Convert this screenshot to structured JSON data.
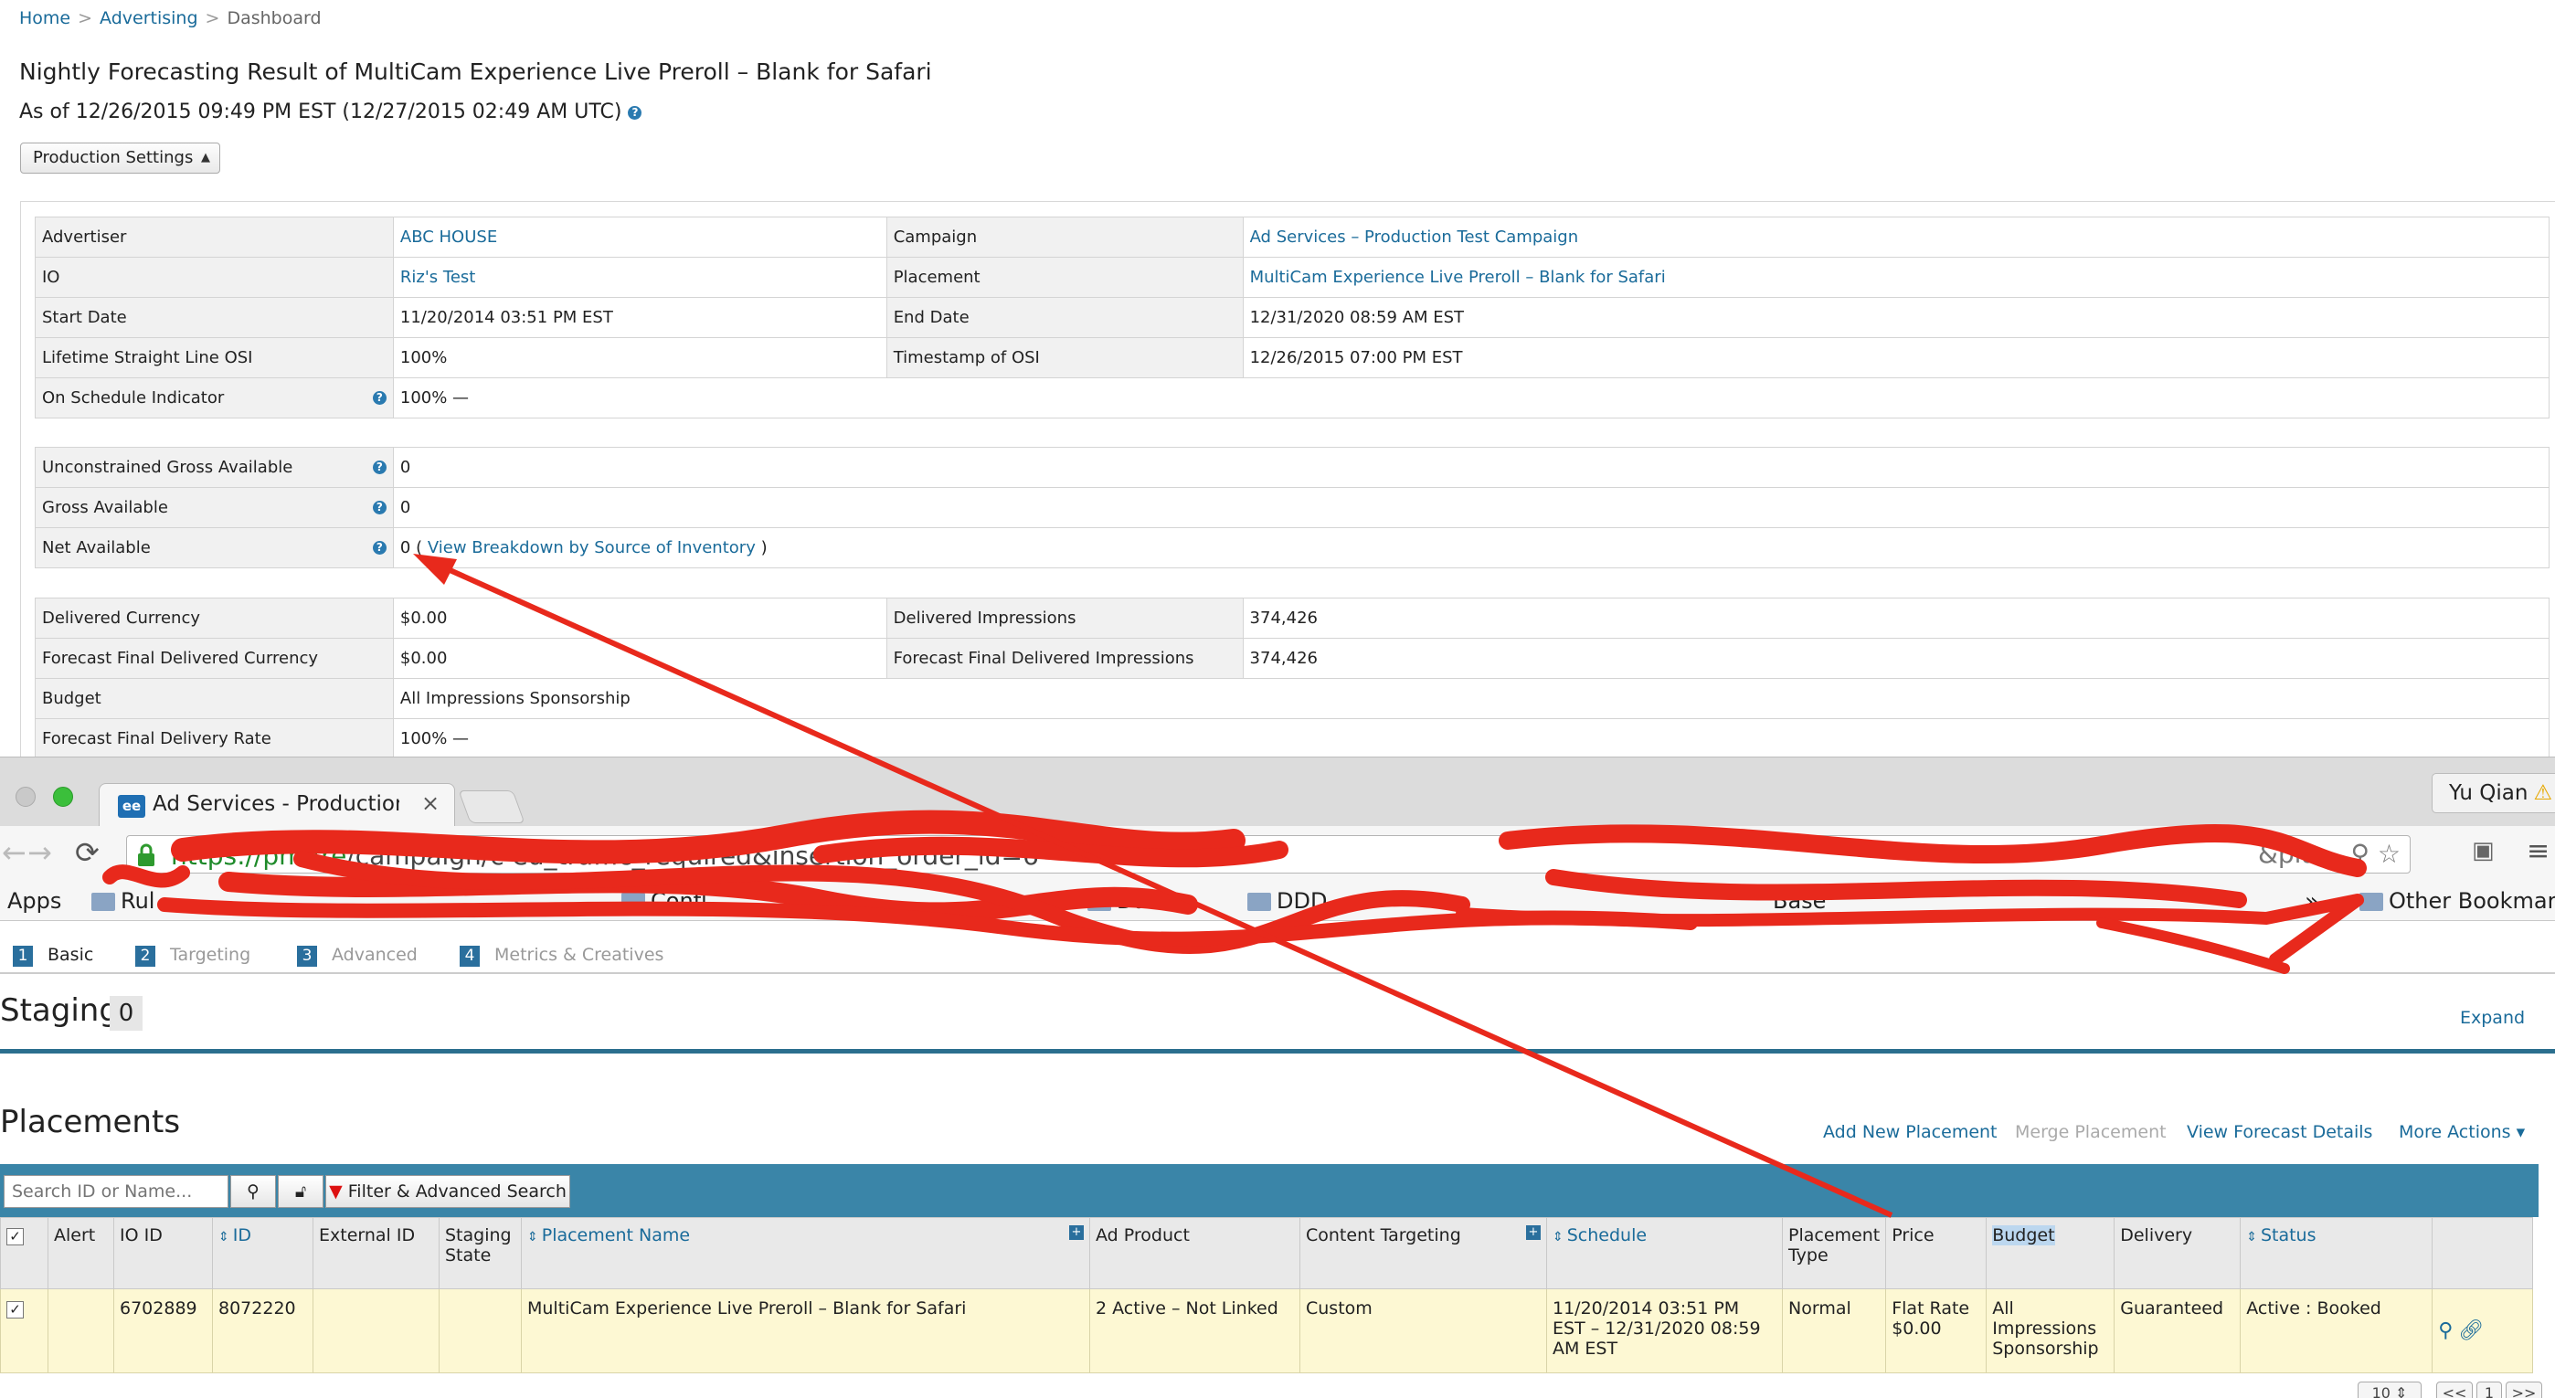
{
  "breadcrumb": {
    "home": "Home",
    "advertising": "Advertising",
    "dashboard": "Dashboard",
    "sep": ">"
  },
  "page": {
    "title": "Nightly Forecasting Result of MultiCam Experience Live Preroll – Blank for Safari",
    "subtitle": "As of 12/26/2015 09:49 PM EST (12/27/2015 02:49 AM UTC)",
    "settings_select": "Production Settings"
  },
  "info": {
    "advertiser_label": "Advertiser",
    "advertiser_value": "ABC HOUSE",
    "campaign_label": "Campaign",
    "campaign_value": "Ad Services – Production Test Campaign",
    "io_label": "IO",
    "io_value": "Riz's Test",
    "placement_label": "Placement",
    "placement_value": "MultiCam Experience Live Preroll – Blank for Safari",
    "start_label": "Start Date",
    "start_value": "11/20/2014 03:51 PM EST",
    "end_label": "End Date",
    "end_value": "12/31/2020 08:59 AM EST",
    "osi_label": "Lifetime Straight Line OSI",
    "osi_value": "100%",
    "ts_label": "Timestamp of OSI",
    "ts_value": "12/26/2015 07:00 PM EST",
    "sched_label": "On Schedule Indicator",
    "sched_value": "100% —"
  },
  "avail": {
    "ugross_label": "Unconstrained Gross Available",
    "ugross_value": "0",
    "gross_label": "Gross Available",
    "gross_value": "0",
    "net_label": "Net Available",
    "net_value": "0 (",
    "net_link": "View Breakdown by Source of Inventory",
    "net_close": ")"
  },
  "delivery": {
    "dc_label": "Delivered Currency",
    "dc_value": "$0.00",
    "di_label": "Delivered Impressions",
    "di_value": "374,426",
    "ffdc_label": "Forecast Final Delivered Currency",
    "ffdc_value": "$0.00",
    "ffdi_label": "Forecast Final Delivered Impressions",
    "ffdi_value": "374,426",
    "budget_label": "Budget",
    "budget_value": "All Impressions Sponsorship",
    "ffdr_label": "Forecast Final Delivery Rate",
    "ffdr_value": "100% —"
  },
  "browser": {
    "tab_title": "Ad Services - Production T",
    "favicon": "ee",
    "profile": "Yu Qian",
    "url_scheme": "https://pm.fre",
    "url_mid": "/campaign/c                    ed_traffic_required&insertion_order_id=6",
    "url_tail": "&pla…",
    "bookmarks": {
      "apps": "Apps",
      "b1": "Rul",
      "b2": "Confl",
      "b3": "Dar",
      "b4": "DDD",
      "b5": "Base",
      "more": "»",
      "other": "Other Bookmarks"
    }
  },
  "app": {
    "steps": [
      {
        "num": "1",
        "label": "Basic"
      },
      {
        "num": "2",
        "label": "Targeting"
      },
      {
        "num": "3",
        "label": "Advanced"
      },
      {
        "num": "4",
        "label": "Metrics & Creatives"
      }
    ],
    "staging_title": "Staging",
    "staging_count": "0",
    "expand": "Expand",
    "placements_title": "Placements",
    "actions": {
      "add": "Add New Placement",
      "merge": "Merge Placement",
      "forecast": "View Forecast Details",
      "more": "More Actions ▾"
    },
    "search_placeholder": "Search ID or Name...",
    "filter_label": "Filter & Advanced Search",
    "columns": [
      "Alert",
      "IO ID",
      "ID",
      "External ID",
      "Staging State",
      "Placement Name",
      "Ad Product",
      "Content Targeting",
      "Schedule",
      "Placement Type",
      "Price",
      "Budget",
      "Delivery",
      "Status"
    ],
    "row": {
      "io_id": "6702889",
      "id": "8072220",
      "name": "MultiCam Experience Live Preroll – Blank for Safari",
      "ad_product": "2 Active – Not Linked",
      "content_targeting": "Custom",
      "schedule": "11/20/2014 03:51 PM EST – 12/31/2020 08:59 AM EST",
      "placement_type": "Normal",
      "price": "Flat Rate $0.00",
      "budget": "All Impressions Sponsorship",
      "delivery": "Guaranteed",
      "status": "Active : Booked"
    },
    "pager": {
      "page_size": "10",
      "prev": "<<",
      "page": "1",
      "next": ">>"
    }
  },
  "colors": {
    "link": "#1a6b9a",
    "teal": "#3a85a8",
    "row_highlight": "#fdf8d3",
    "annotation_red": "#e8291c"
  },
  "icons": [
    "help-icon",
    "lock-icon",
    "reload-icon",
    "star-icon",
    "search-icon",
    "unlock-icon",
    "filter-icon",
    "zoom-icon",
    "link-icon",
    "folder-icon"
  ]
}
